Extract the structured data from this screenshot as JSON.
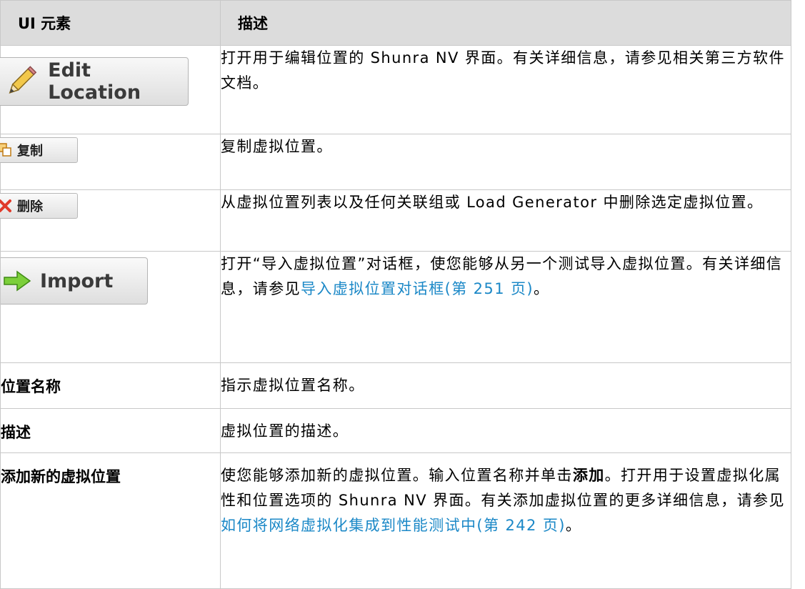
{
  "header": {
    "col1": "UI 元素",
    "col2": "描述"
  },
  "rows": [
    {
      "button": {
        "label": "Edit Location",
        "icon": "pencil-icon"
      },
      "desc": "打开用于编辑位置的 Shunra NV 界面。有关详细信息，请参见相关第三方软件文档。"
    },
    {
      "button": {
        "label": "复制",
        "icon": "copy-icon"
      },
      "desc": "复制虚拟位置。"
    },
    {
      "button": {
        "label": "删除",
        "icon": "delete-x-icon"
      },
      "desc": "从虚拟位置列表以及任何关联组或 Load Generator 中删除选定虚拟位置。"
    },
    {
      "button": {
        "label": "Import",
        "icon": "green-arrow-icon"
      },
      "desc_before": "打开“导入虚拟位置”对话框，使您能够从另一个测试导入虚拟位置。有关详细信息，请参见",
      "desc_link": "导入虚拟位置对话框(第 251 页)",
      "desc_after": "。"
    },
    {
      "label": "位置名称",
      "desc": "指示虚拟位置名称。"
    },
    {
      "label": "描述",
      "desc": "虚拟位置的描述。"
    },
    {
      "label": "添加新的虚拟位置",
      "desc_part1": "使您能够添加新的虚拟位置。输入位置名称并单击",
      "desc_bold": "添加",
      "desc_part2": "。打开用于设置虚拟化属性和位置选项的 Shunra NV 界面。有关添加虚拟位置的更多详细信息，请参见",
      "desc_link": "如何将网络虚拟化集成到性能测试中(第 242 页)",
      "desc_after": "。"
    }
  ],
  "colors": {
    "header_bg": "#dcdcdc",
    "link": "#1b88c7",
    "border": "#c8c8c8"
  }
}
